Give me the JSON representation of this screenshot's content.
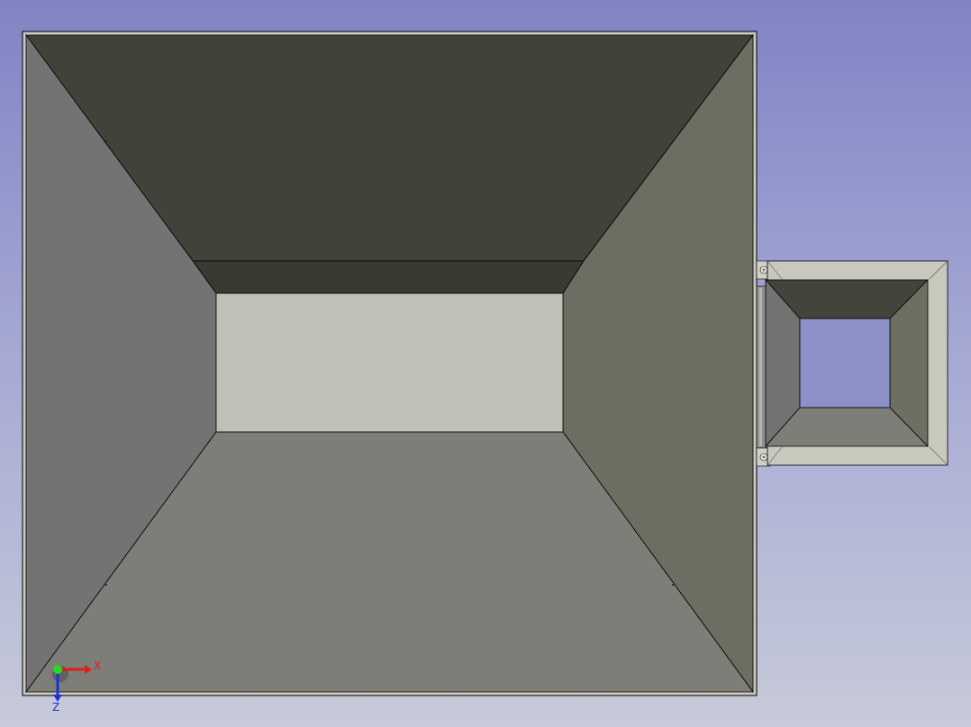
{
  "viewport": {
    "background_top": "#8183c4",
    "background_bottom": "#c7cad9"
  },
  "model": {
    "hopper": {
      "face_top": "#42423a",
      "face_top_inner": "#3a3a33",
      "face_left": "#737373",
      "face_right": "#6d6d62",
      "face_bottom": "#7c7e77",
      "opening": "#c0c0b9",
      "outline": "#000000"
    },
    "side_duct": {
      "frame": "#c8c8bd",
      "face_top": "#44443c",
      "face_left": "#727272",
      "face_right": "#6e6e63",
      "face_bottom": "#7c7e77",
      "opening": "#8e91c8",
      "hinge": "#8f8f8f"
    }
  },
  "axis_indicator": {
    "x_label": "X",
    "z_label": "Z",
    "x_color": "#e31b1b",
    "z_color": "#1f2fd8",
    "origin_color": "#22dd22"
  }
}
